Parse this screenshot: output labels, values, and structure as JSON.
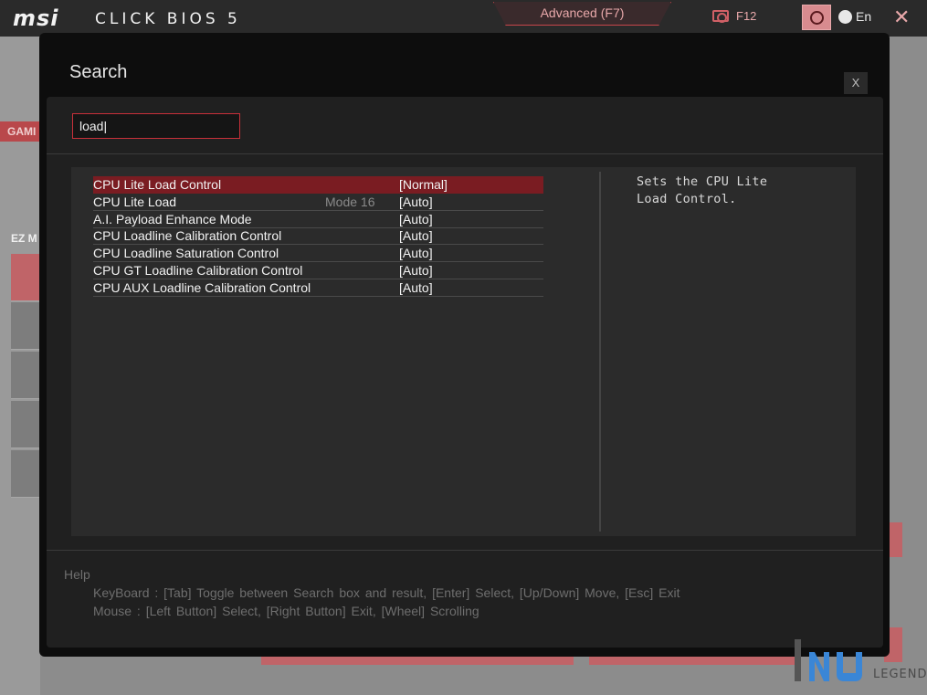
{
  "header": {
    "brand": "msi",
    "product": "CLICK BIOS 5",
    "mode_tab": "Advanced (F7)",
    "screenshot_label": "F12",
    "language": "En"
  },
  "background": {
    "side_tab": "GAMI",
    "ez_label": "EZ M"
  },
  "dialog": {
    "title": "Search",
    "close_label": "X",
    "search_value": "load|",
    "results": [
      {
        "name": "CPU Lite Load Control",
        "note": "",
        "value": "[Normal]",
        "selected": true
      },
      {
        "name": "CPU Lite Load",
        "note": "Mode 16",
        "value": "[Auto]",
        "selected": false
      },
      {
        "name": "A.I. Payload Enhance Mode",
        "note": "",
        "value": "[Auto]",
        "selected": false
      },
      {
        "name": "CPU Loadline Calibration Control",
        "note": "",
        "value": "[Auto]",
        "selected": false
      },
      {
        "name": "CPU Loadline Saturation Control",
        "note": "",
        "value": "[Auto]",
        "selected": false
      },
      {
        "name": "CPU GT Loadline Calibration Control",
        "note": "",
        "value": "[Auto]",
        "selected": false
      },
      {
        "name": "CPU AUX Loadline Calibration Control",
        "note": "",
        "value": "[Auto]",
        "selected": false
      }
    ],
    "description_lines": [
      "Sets the CPU Lite",
      "Load Control."
    ],
    "help": {
      "title": "Help",
      "keyboard": "KeyBoard :  [Tab]  Toggle between Search box and result,   [Enter]  Select,   [Up/Down]  Move,   [Esc]  Exit",
      "mouse": "Mouse     :  [Left Button]  Select,   [Right Button]  Exit,   [Wheel]  Scrolling"
    }
  },
  "watermark": {
    "text": "LEGEND"
  },
  "colors": {
    "accent": "#c8303a",
    "selected_row": "#7a1c22"
  }
}
